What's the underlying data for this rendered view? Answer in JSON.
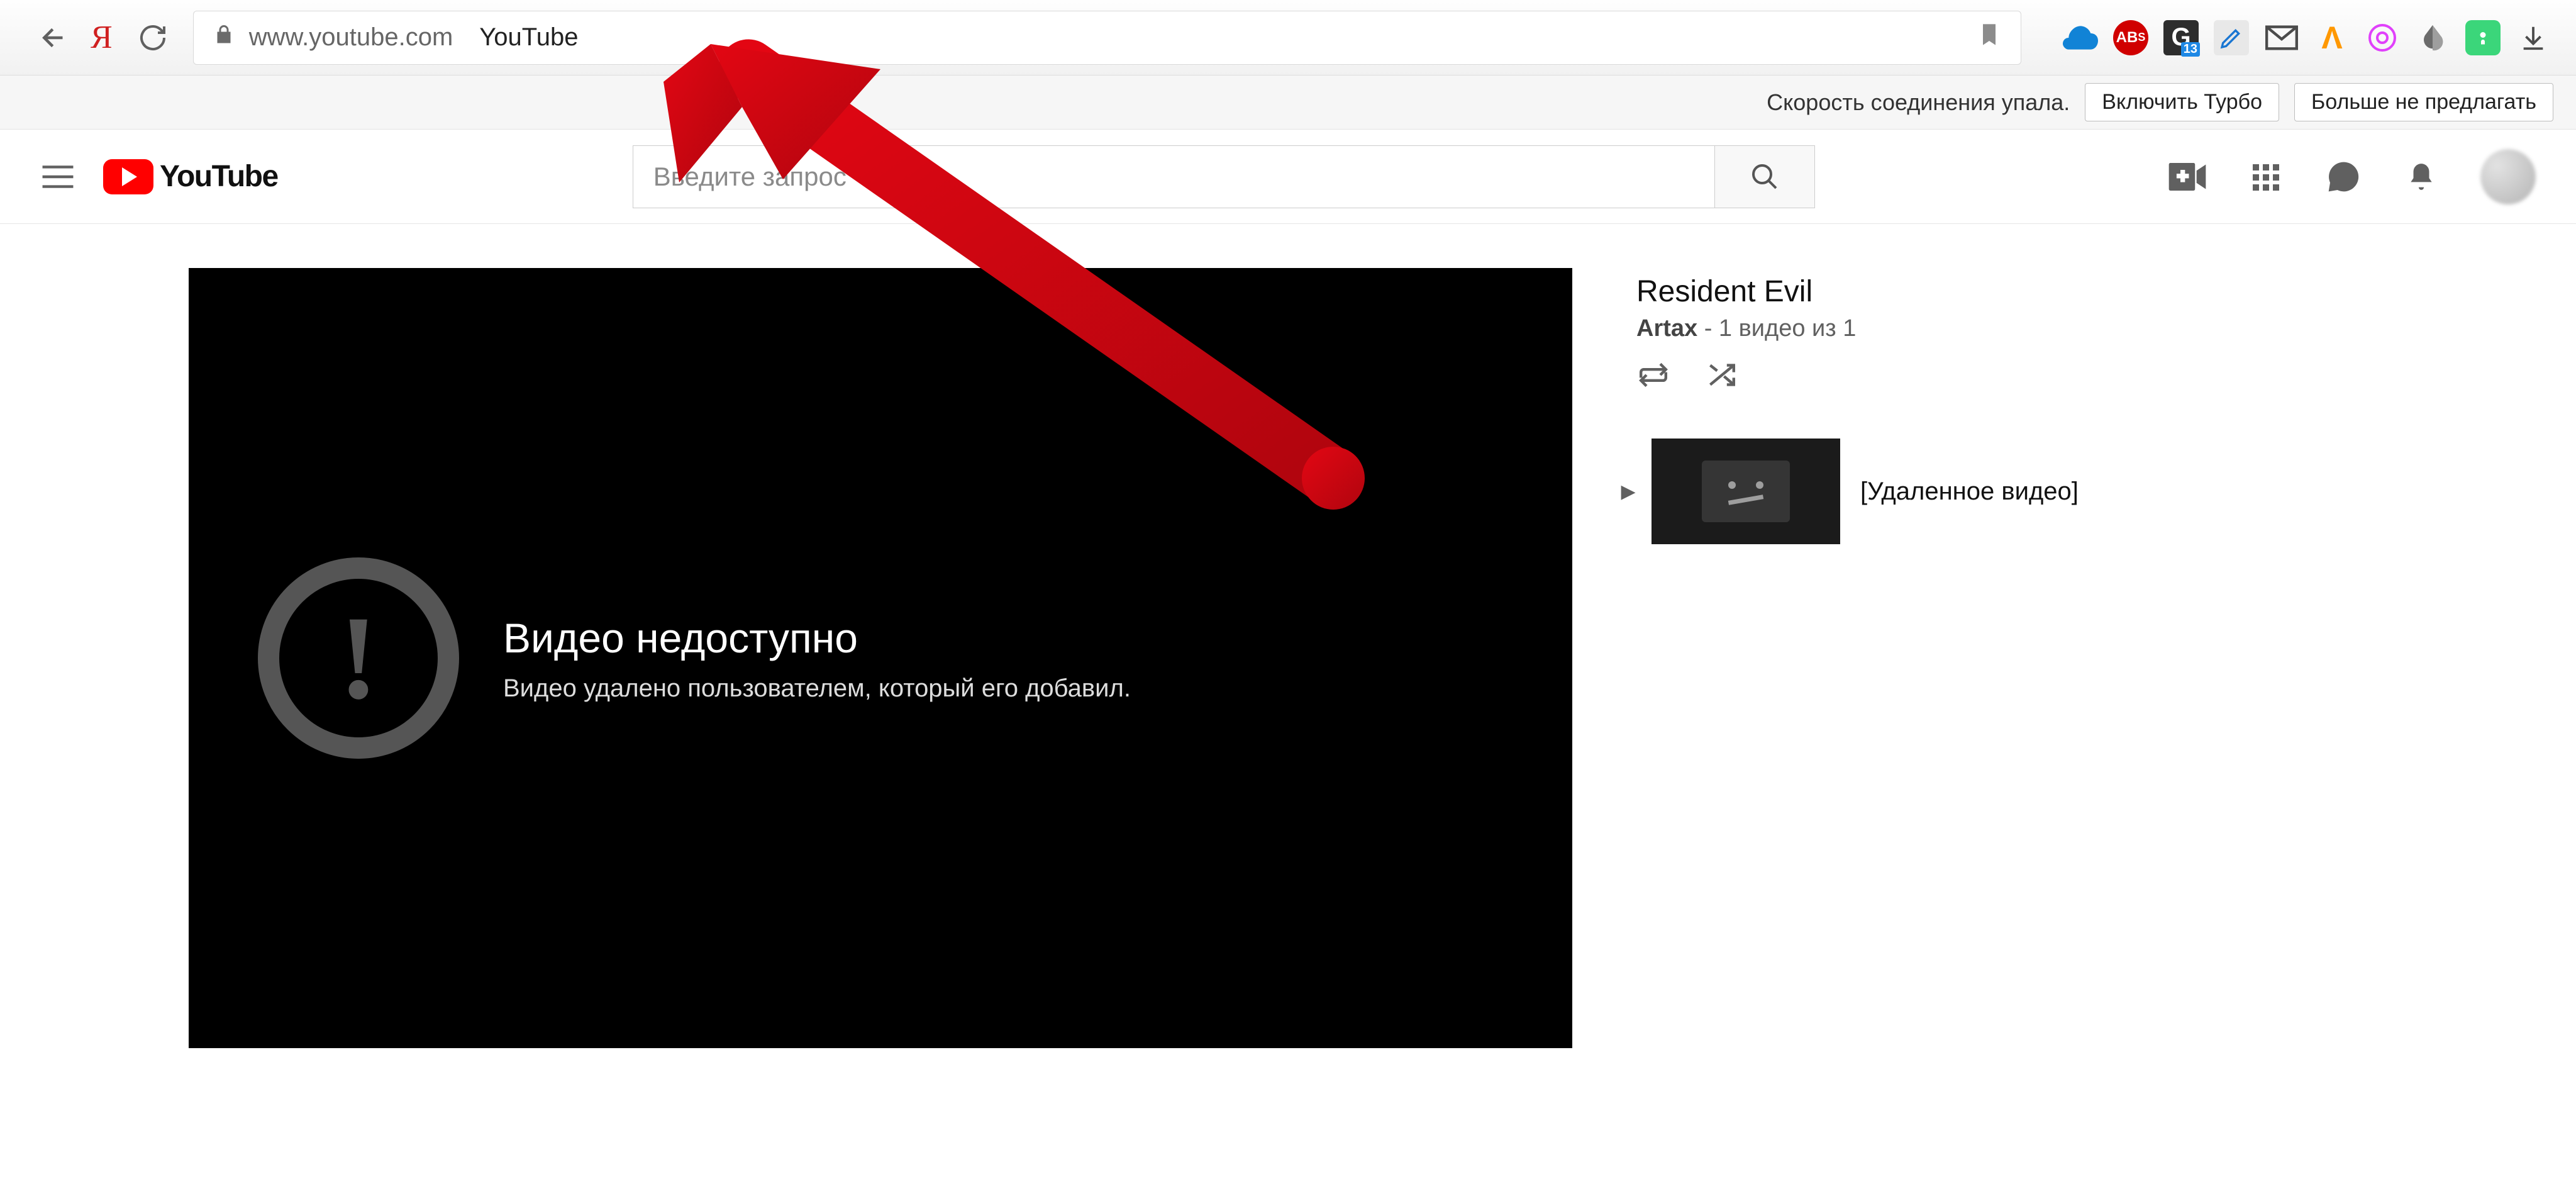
{
  "browser": {
    "url": "www.youtube.com",
    "site_title": "YouTube"
  },
  "infobar": {
    "msg": "Скорость соединения упала.",
    "btn_enable": "Включить Турбо",
    "btn_dismiss": "Больше не предлагать"
  },
  "yt": {
    "product": "YouTube",
    "search_placeholder": "Введите запрос"
  },
  "player": {
    "title": "Видео недоступно",
    "subtitle": "Видео удалено пользователем, который его добавил."
  },
  "playlist": {
    "title": "Resident Evil",
    "author": "Artax",
    "meta": " - 1 видео из 1",
    "items": [
      {
        "label": "[Удаленное видео]"
      }
    ]
  },
  "ext_badges": {
    "g_count": "13",
    "ab_suffix": "S"
  },
  "colors": {
    "yt_red": "#ff0000",
    "arrow_red": "#e30613"
  }
}
